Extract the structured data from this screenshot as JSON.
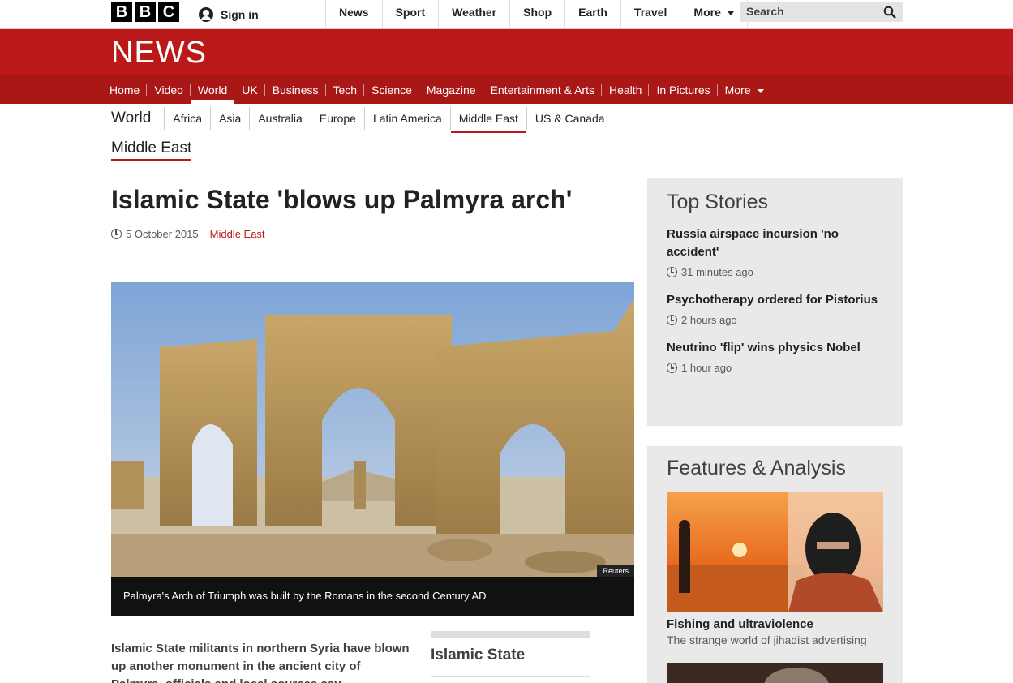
{
  "brand": {
    "letters": [
      "B",
      "B",
      "C"
    ]
  },
  "account": {
    "signin_label": "Sign in"
  },
  "top_nav": [
    {
      "label": "News"
    },
    {
      "label": "Sport"
    },
    {
      "label": "Weather"
    },
    {
      "label": "Shop"
    },
    {
      "label": "Earth"
    },
    {
      "label": "Travel"
    },
    {
      "label": "More"
    }
  ],
  "search": {
    "placeholder": "Search",
    "icon": "search-icon"
  },
  "masthead": {
    "title": "NEWS",
    "color": "#bb1919"
  },
  "main_nav": [
    {
      "label": "Home"
    },
    {
      "label": "Video"
    },
    {
      "label": "World",
      "active": true
    },
    {
      "label": "UK"
    },
    {
      "label": "Business"
    },
    {
      "label": "Tech"
    },
    {
      "label": "Science"
    },
    {
      "label": "Magazine"
    },
    {
      "label": "Entertainment & Arts"
    },
    {
      "label": "Health"
    },
    {
      "label": "In Pictures"
    },
    {
      "label": "More"
    }
  ],
  "sub_nav": {
    "section": "World",
    "items": [
      {
        "label": "Africa"
      },
      {
        "label": "Asia"
      },
      {
        "label": "Australia"
      },
      {
        "label": "Europe"
      },
      {
        "label": "Latin America"
      },
      {
        "label": "Middle East",
        "active": true
      },
      {
        "label": "US & Canada"
      }
    ],
    "current_page": "Middle East"
  },
  "article": {
    "headline": "Islamic State 'blows up Palmyra arch'",
    "date": "5 October 2015",
    "category": "Middle East",
    "image_credit": "Reuters",
    "caption": "Palmyra's Arch of Triumph was built by the Romans in the second Century AD",
    "intro": "Islamic State militants in northern Syria have blown up another monument in the ancient city of Palmyra, officials and local sources say."
  },
  "related": {
    "title": "Islamic State"
  },
  "top_stories": {
    "title": "Top Stories",
    "items": [
      {
        "title": "Russia airspace incursion 'no accident'",
        "time": "31 minutes ago"
      },
      {
        "title": "Psychotherapy ordered for Pistorius",
        "time": "2 hours ago"
      },
      {
        "title": "Neutrino 'flip' wins physics Nobel",
        "time": "1 hour ago"
      }
    ]
  },
  "features": {
    "title": "Features & Analysis",
    "items": [
      {
        "title": "Fishing and ultraviolence",
        "summary": "The strange world of jihadist advertising"
      }
    ]
  }
}
